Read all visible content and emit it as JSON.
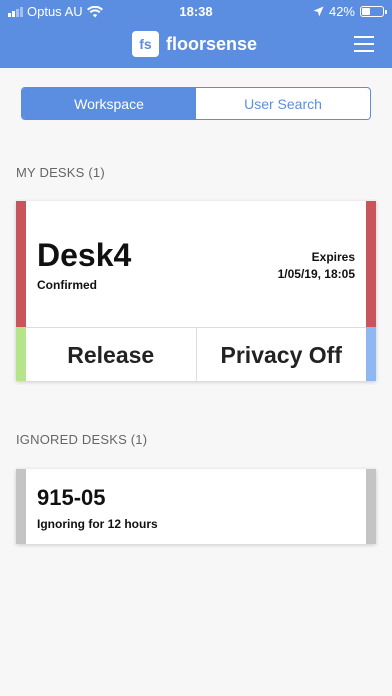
{
  "status_bar": {
    "carrier": "Optus AU",
    "time": "18:38",
    "battery_percent": "42%",
    "battery_level": 0.42
  },
  "header": {
    "logo_text": "fs",
    "brand": "floorsense",
    "menu_icon": "hamburger-menu-icon",
    "color": "#5b8ee0"
  },
  "tabs": [
    {
      "label": "Workspace",
      "active": true
    },
    {
      "label": "User Search",
      "active": false
    }
  ],
  "my_desks": {
    "heading": "MY DESKS (1)",
    "desk": {
      "name": "Desk4",
      "status": "Confirmed",
      "expires_label": "Expires",
      "expires_value": "1/05/19, 18:05",
      "status_color": "#c8545c",
      "release_label": "Release",
      "privacy_label": "Privacy Off",
      "release_color": "#b6e48a",
      "privacy_color": "#8fb8f2"
    }
  },
  "ignored_desks": {
    "heading": "IGNORED DESKS (1)",
    "desk": {
      "name": "915-05",
      "note": "Ignoring for 12 hours",
      "strip_color": "#c4c4c4"
    }
  }
}
